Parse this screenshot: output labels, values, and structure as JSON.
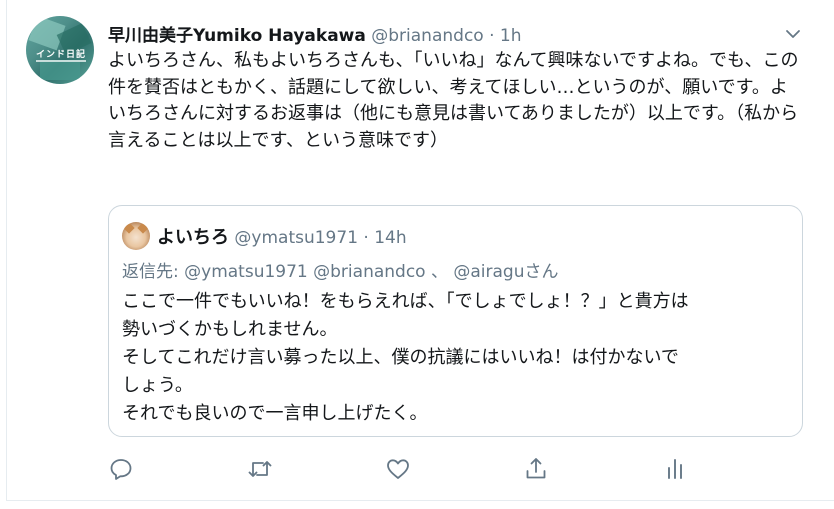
{
  "tweet": {
    "author_name": "早川由美子Yumiko Hayakawa",
    "handle": "@brianandco",
    "separator": "·",
    "time": "1h",
    "body": "よいちろさん、私もよいちろさんも、「いいね」なんて興味ないですよね。でも、この件を賛否はともかく、話題にして欲しい、考えてほしい…というのが、願いです。よいちろさんに対するお返事は（他にも意見は書いてありましたが）以上です。（私から言えることは以上です、という意味です）",
    "avatar_text": "インド日記"
  },
  "quote": {
    "author_name": "よいちろ",
    "handle": "@ymatsu1971",
    "separator": "·",
    "time": "14h",
    "reply_prefix": "返信先:",
    "reply_mentions": "@ymatsu1971 @brianandco 、 @airagu",
    "reply_suffix": "さん",
    "body_lines": [
      "ここで一件でもいいね！をもらえれば、「でしょでしょ！？」と貴方は",
      "勢いづくかもしれません。",
      "そしてこれだけ言い募った以上、僕の抗議にはいいね！は付かないで",
      "しょう。",
      "それでも良いので一言申し上げたく。"
    ]
  },
  "icons": {
    "reply": "reply-icon",
    "retweet": "retweet-icon",
    "like": "heart-icon",
    "share": "share-icon",
    "analytics": "analytics-icon",
    "menu": "chevron-down-icon"
  },
  "colors": {
    "text": "#14171a",
    "secondary": "#657786",
    "border": "#ccd6dd"
  }
}
